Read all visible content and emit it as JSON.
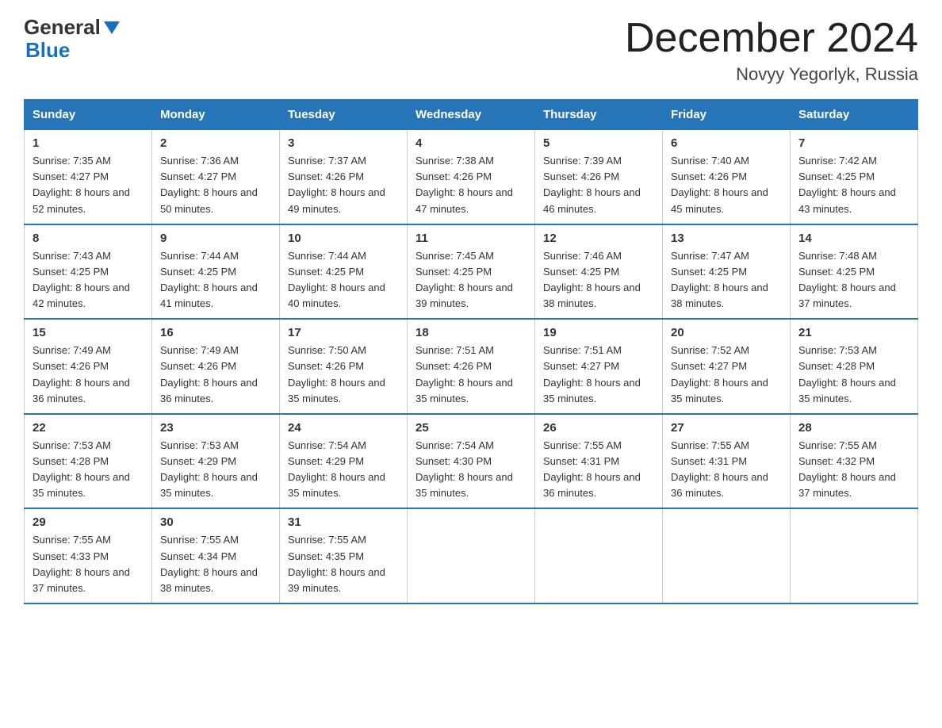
{
  "header": {
    "logo_general": "General",
    "logo_blue": "Blue",
    "title": "December 2024",
    "location": "Novyy Yegorlyk, Russia"
  },
  "days_of_week": [
    "Sunday",
    "Monday",
    "Tuesday",
    "Wednesday",
    "Thursday",
    "Friday",
    "Saturday"
  ],
  "weeks": [
    [
      {
        "day": "1",
        "sunrise": "7:35 AM",
        "sunset": "4:27 PM",
        "daylight": "8 hours and 52 minutes."
      },
      {
        "day": "2",
        "sunrise": "7:36 AM",
        "sunset": "4:27 PM",
        "daylight": "8 hours and 50 minutes."
      },
      {
        "day": "3",
        "sunrise": "7:37 AM",
        "sunset": "4:26 PM",
        "daylight": "8 hours and 49 minutes."
      },
      {
        "day": "4",
        "sunrise": "7:38 AM",
        "sunset": "4:26 PM",
        "daylight": "8 hours and 47 minutes."
      },
      {
        "day": "5",
        "sunrise": "7:39 AM",
        "sunset": "4:26 PM",
        "daylight": "8 hours and 46 minutes."
      },
      {
        "day": "6",
        "sunrise": "7:40 AM",
        "sunset": "4:26 PM",
        "daylight": "8 hours and 45 minutes."
      },
      {
        "day": "7",
        "sunrise": "7:42 AM",
        "sunset": "4:25 PM",
        "daylight": "8 hours and 43 minutes."
      }
    ],
    [
      {
        "day": "8",
        "sunrise": "7:43 AM",
        "sunset": "4:25 PM",
        "daylight": "8 hours and 42 minutes."
      },
      {
        "day": "9",
        "sunrise": "7:44 AM",
        "sunset": "4:25 PM",
        "daylight": "8 hours and 41 minutes."
      },
      {
        "day": "10",
        "sunrise": "7:44 AM",
        "sunset": "4:25 PM",
        "daylight": "8 hours and 40 minutes."
      },
      {
        "day": "11",
        "sunrise": "7:45 AM",
        "sunset": "4:25 PM",
        "daylight": "8 hours and 39 minutes."
      },
      {
        "day": "12",
        "sunrise": "7:46 AM",
        "sunset": "4:25 PM",
        "daylight": "8 hours and 38 minutes."
      },
      {
        "day": "13",
        "sunrise": "7:47 AM",
        "sunset": "4:25 PM",
        "daylight": "8 hours and 38 minutes."
      },
      {
        "day": "14",
        "sunrise": "7:48 AM",
        "sunset": "4:25 PM",
        "daylight": "8 hours and 37 minutes."
      }
    ],
    [
      {
        "day": "15",
        "sunrise": "7:49 AM",
        "sunset": "4:26 PM",
        "daylight": "8 hours and 36 minutes."
      },
      {
        "day": "16",
        "sunrise": "7:49 AM",
        "sunset": "4:26 PM",
        "daylight": "8 hours and 36 minutes."
      },
      {
        "day": "17",
        "sunrise": "7:50 AM",
        "sunset": "4:26 PM",
        "daylight": "8 hours and 35 minutes."
      },
      {
        "day": "18",
        "sunrise": "7:51 AM",
        "sunset": "4:26 PM",
        "daylight": "8 hours and 35 minutes."
      },
      {
        "day": "19",
        "sunrise": "7:51 AM",
        "sunset": "4:27 PM",
        "daylight": "8 hours and 35 minutes."
      },
      {
        "day": "20",
        "sunrise": "7:52 AM",
        "sunset": "4:27 PM",
        "daylight": "8 hours and 35 minutes."
      },
      {
        "day": "21",
        "sunrise": "7:53 AM",
        "sunset": "4:28 PM",
        "daylight": "8 hours and 35 minutes."
      }
    ],
    [
      {
        "day": "22",
        "sunrise": "7:53 AM",
        "sunset": "4:28 PM",
        "daylight": "8 hours and 35 minutes."
      },
      {
        "day": "23",
        "sunrise": "7:53 AM",
        "sunset": "4:29 PM",
        "daylight": "8 hours and 35 minutes."
      },
      {
        "day": "24",
        "sunrise": "7:54 AM",
        "sunset": "4:29 PM",
        "daylight": "8 hours and 35 minutes."
      },
      {
        "day": "25",
        "sunrise": "7:54 AM",
        "sunset": "4:30 PM",
        "daylight": "8 hours and 35 minutes."
      },
      {
        "day": "26",
        "sunrise": "7:55 AM",
        "sunset": "4:31 PM",
        "daylight": "8 hours and 36 minutes."
      },
      {
        "day": "27",
        "sunrise": "7:55 AM",
        "sunset": "4:31 PM",
        "daylight": "8 hours and 36 minutes."
      },
      {
        "day": "28",
        "sunrise": "7:55 AM",
        "sunset": "4:32 PM",
        "daylight": "8 hours and 37 minutes."
      }
    ],
    [
      {
        "day": "29",
        "sunrise": "7:55 AM",
        "sunset": "4:33 PM",
        "daylight": "8 hours and 37 minutes."
      },
      {
        "day": "30",
        "sunrise": "7:55 AM",
        "sunset": "4:34 PM",
        "daylight": "8 hours and 38 minutes."
      },
      {
        "day": "31",
        "sunrise": "7:55 AM",
        "sunset": "4:35 PM",
        "daylight": "8 hours and 39 minutes."
      },
      null,
      null,
      null,
      null
    ]
  ]
}
